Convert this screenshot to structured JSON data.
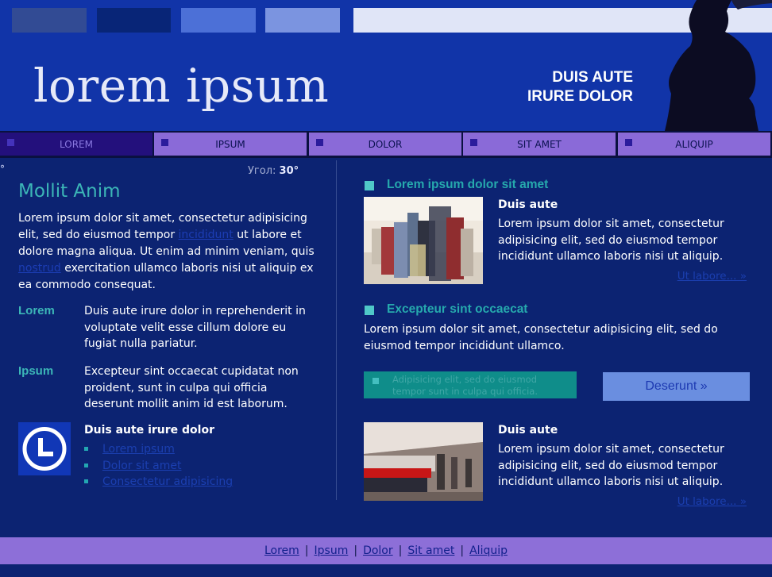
{
  "header": {
    "logo": "lorem ipsum",
    "tagline_line1": "DUIS AUTE",
    "tagline_line2": "IRURE DOLOR"
  },
  "nav": {
    "items": [
      {
        "label": "LOREM",
        "active": true
      },
      {
        "label": "IPSUM",
        "active": false
      },
      {
        "label": "DOLOR",
        "active": false
      },
      {
        "label": "SIT AMET",
        "active": false
      },
      {
        "label": "ALIQUIP",
        "active": false
      }
    ]
  },
  "left": {
    "degree_mark": "°",
    "angle_label": "Угол:",
    "angle_value": "30°",
    "heading": "Mollit Anim",
    "intro_1": "Lorem ipsum dolor sit amet, consectetur adipisicing elit, sed do eiusmod tempor",
    "intro_link_1": "incididunt",
    "intro_2": "ut labore et dolore magna aliqua. Ut enim ad minim veniam, quis",
    "intro_link_2": "nostrud",
    "intro_3": "exercitation ullamco laboris nisi ut aliquip ex ea commodo consequat.",
    "terms": [
      {
        "term": "Lorem",
        "definition": "Duis aute irure dolor in reprehenderit in voluptate velit esse cillum dolore eu fugiat nulla pariatur."
      },
      {
        "term": "Ipsum",
        "definition": "Excepteur sint occaecat cupidatat non proident, sunt in culpa qui officia deserunt mollit anim id est laborum."
      }
    ],
    "links_title": "Duis aute irure dolor",
    "links": [
      "Lorem ipsum",
      "Dolor sit amet",
      "Consectetur adipisicing"
    ]
  },
  "right": {
    "section1_title": "Lorem ipsum dolor sit amet",
    "card1": {
      "heading": "Duis aute",
      "text": "Lorem ipsum dolor sit amet, consectetur adipisicing elit, sed do eiusmod tempor incididunt ullamco laboris nisi ut aliquip.",
      "more": "Ut labore... »"
    },
    "section2_title": "Excepteur sint occaecat",
    "section2_text": "Lorem ipsum dolor sit amet, consectetur adipisicing elit, sed do eiusmod tempor incididunt ullamco.",
    "teal_box_text": "Adipisicing elit, sed do eiusmod tempor sunt in culpa qui officia.",
    "button_label": "Deserunt »",
    "card2": {
      "heading": "Duis aute",
      "text": "Lorem ipsum dolor sit amet, consectetur adipisicing elit, sed do eiusmod tempor incididunt ullamco laboris nisi ut aliquip.",
      "more": "Ut labore... »"
    }
  },
  "footer": {
    "links": [
      "Lorem",
      "Ipsum",
      "Dolor",
      "Sit amet",
      "Aliquip"
    ],
    "separator": "|"
  },
  "colors": {
    "background": "#0c2372",
    "header": "#1134a8",
    "nav_item": "#8a6ad8",
    "nav_active": "#23107c",
    "accent_teal": "#3cb6b7",
    "button": "#6a8ee0",
    "footer": "#8d6fd8"
  },
  "icons": [
    "clock-icon",
    "silhouette-image",
    "crowd-photo",
    "train-photo"
  ]
}
